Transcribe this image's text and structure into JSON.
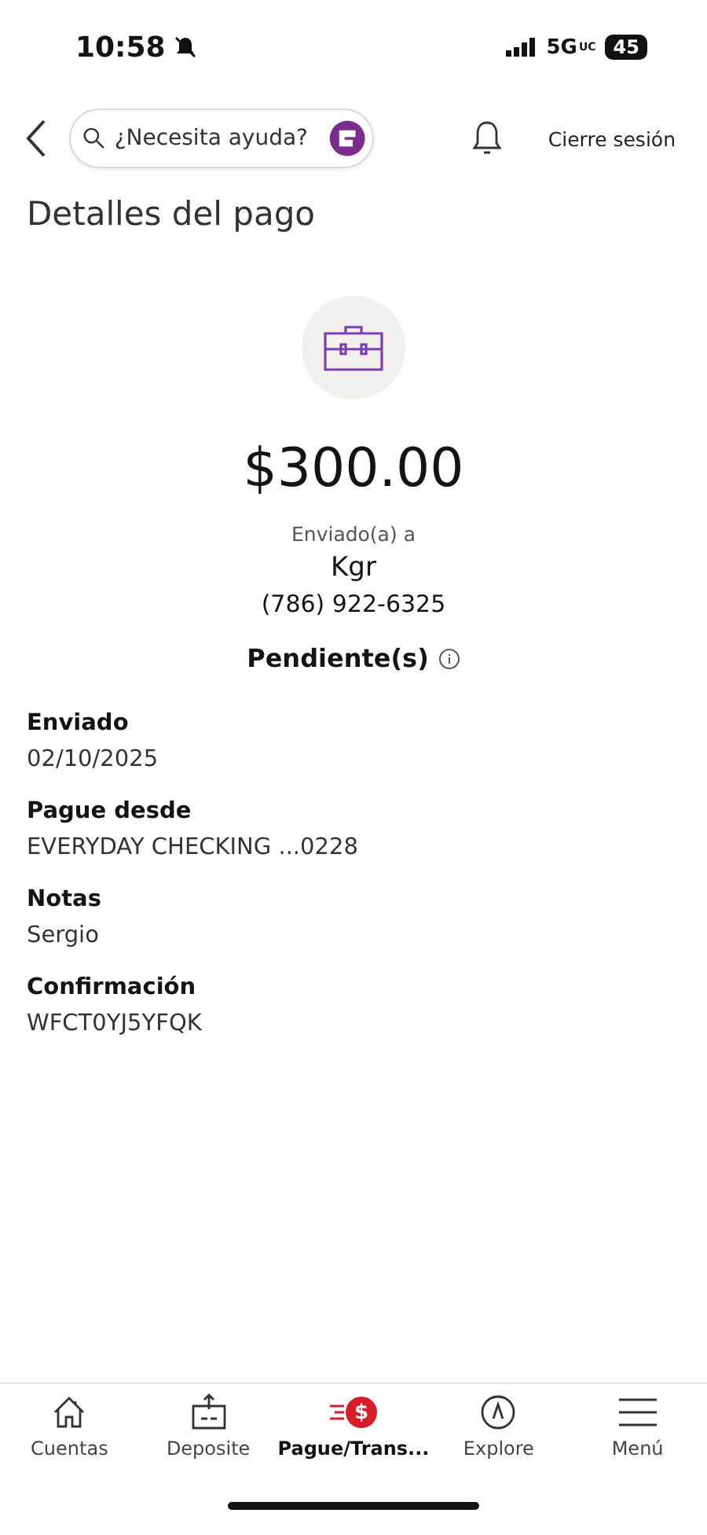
{
  "status_bar": {
    "time": "10:58",
    "network": "5G",
    "network_sub": "UC",
    "battery": "45"
  },
  "header": {
    "search": {
      "placeholder": "¿Necesita ayuda?"
    },
    "logout": "Cierre sesión"
  },
  "title": "Detalles del pago",
  "payment": {
    "amount": "$300.00",
    "sent_to_label": "Enviado(a) a",
    "recipient": "Kgr",
    "phone": "(786) 922-6325",
    "status": "Pendiente(s)"
  },
  "details": [
    {
      "label": "Enviado",
      "value": "02/10/2025"
    },
    {
      "label": "Pague desde",
      "value": "EVERYDAY CHECKING ...0228"
    },
    {
      "label": "Notas",
      "value": "Sergio"
    },
    {
      "label": "Confirmación",
      "value": "WFCT0YJ5YFQK"
    }
  ],
  "tabs": [
    {
      "kind": "home",
      "label": "Cuentas",
      "selected": false
    },
    {
      "kind": "deposit",
      "label": "Deposite",
      "selected": false
    },
    {
      "kind": "pay",
      "label": "Pague/Trans...",
      "badge": "$",
      "selected": true
    },
    {
      "kind": "explore",
      "label": "Explore",
      "selected": false
    },
    {
      "kind": "menu",
      "label": "Menú",
      "selected": false
    }
  ]
}
